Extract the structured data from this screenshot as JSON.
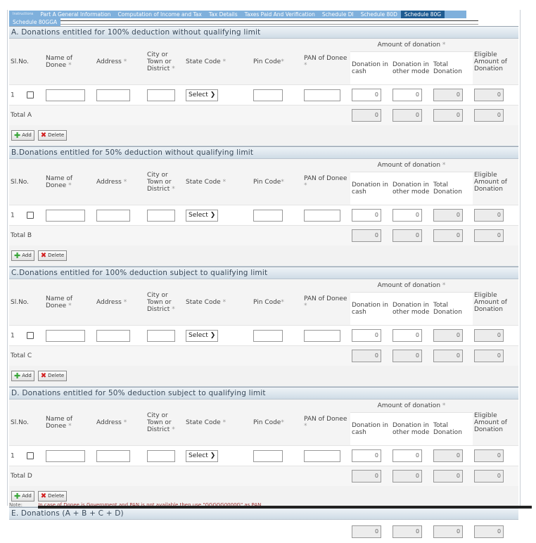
{
  "tabs": {
    "row1": [
      "Instructions",
      "Part A General Information",
      "Computation of Income and Tax",
      "Tax Details",
      "Taxes Paid And Verification",
      "Schedule DI",
      "Schedule 80D",
      "Schedule 80G"
    ],
    "row2": [
      "Schedule 80GGA"
    ],
    "active": "Schedule 80G"
  },
  "columns": {
    "slno": "Sl.No.",
    "name": "Name of Donee",
    "address": "Address",
    "city": "City or Town or District",
    "state": "State Code",
    "pin": "Pin Code",
    "pan": "PAN of Donee",
    "amount_group": "Amount of donation",
    "cash": "Donation in cash",
    "other": "Donation in other mode",
    "total": "Total Donation",
    "eligible": "Eligible Amount of Donation",
    "required_mark": "*"
  },
  "buttons": {
    "add": "Add",
    "delete": "Delete"
  },
  "select_default": "Select",
  "sections": [
    {
      "title": "A. Donations entitled for 100% deduction without qualifying limit",
      "total_label": "Total A",
      "row": {
        "slno": "1",
        "cash": "0",
        "other": "0",
        "total": "0",
        "eligible": "0"
      },
      "totals": {
        "cash": "0",
        "other": "0",
        "total": "0",
        "eligible": "0"
      }
    },
    {
      "title": "B.Donations entitled for 50% deduction without qualifying limit",
      "total_label": "Total B",
      "row": {
        "slno": "1",
        "cash": "0",
        "other": "0",
        "total": "0",
        "eligible": "0"
      },
      "totals": {
        "cash": "0",
        "other": "0",
        "total": "0",
        "eligible": "0"
      }
    },
    {
      "title": "C.Donations entitled for 100% deduction subject to qualifying limit",
      "total_label": "Total C",
      "row": {
        "slno": "1",
        "cash": "0",
        "other": "0",
        "total": "0",
        "eligible": "0"
      },
      "totals": {
        "cash": "0",
        "other": "0",
        "total": "0",
        "eligible": "0"
      }
    },
    {
      "title": "D. Donations entitled for 50% deduction subject to qualifying limit",
      "total_label": "Total D",
      "row": {
        "slno": "1",
        "cash": "0",
        "other": "0",
        "total": "0",
        "eligible": "0"
      },
      "totals": {
        "cash": "0",
        "other": "0",
        "total": "0",
        "eligible": "0"
      }
    }
  ],
  "summary": {
    "title": "E. Donations (A + B + C + D)",
    "totals": {
      "cash": "0",
      "other": "0",
      "total": "0",
      "eligible": "0"
    }
  },
  "note": {
    "label": "Note:",
    "text": "In case of Donee is Government and PAN is not available then use \"GGGGG0000G\" as PAN"
  }
}
